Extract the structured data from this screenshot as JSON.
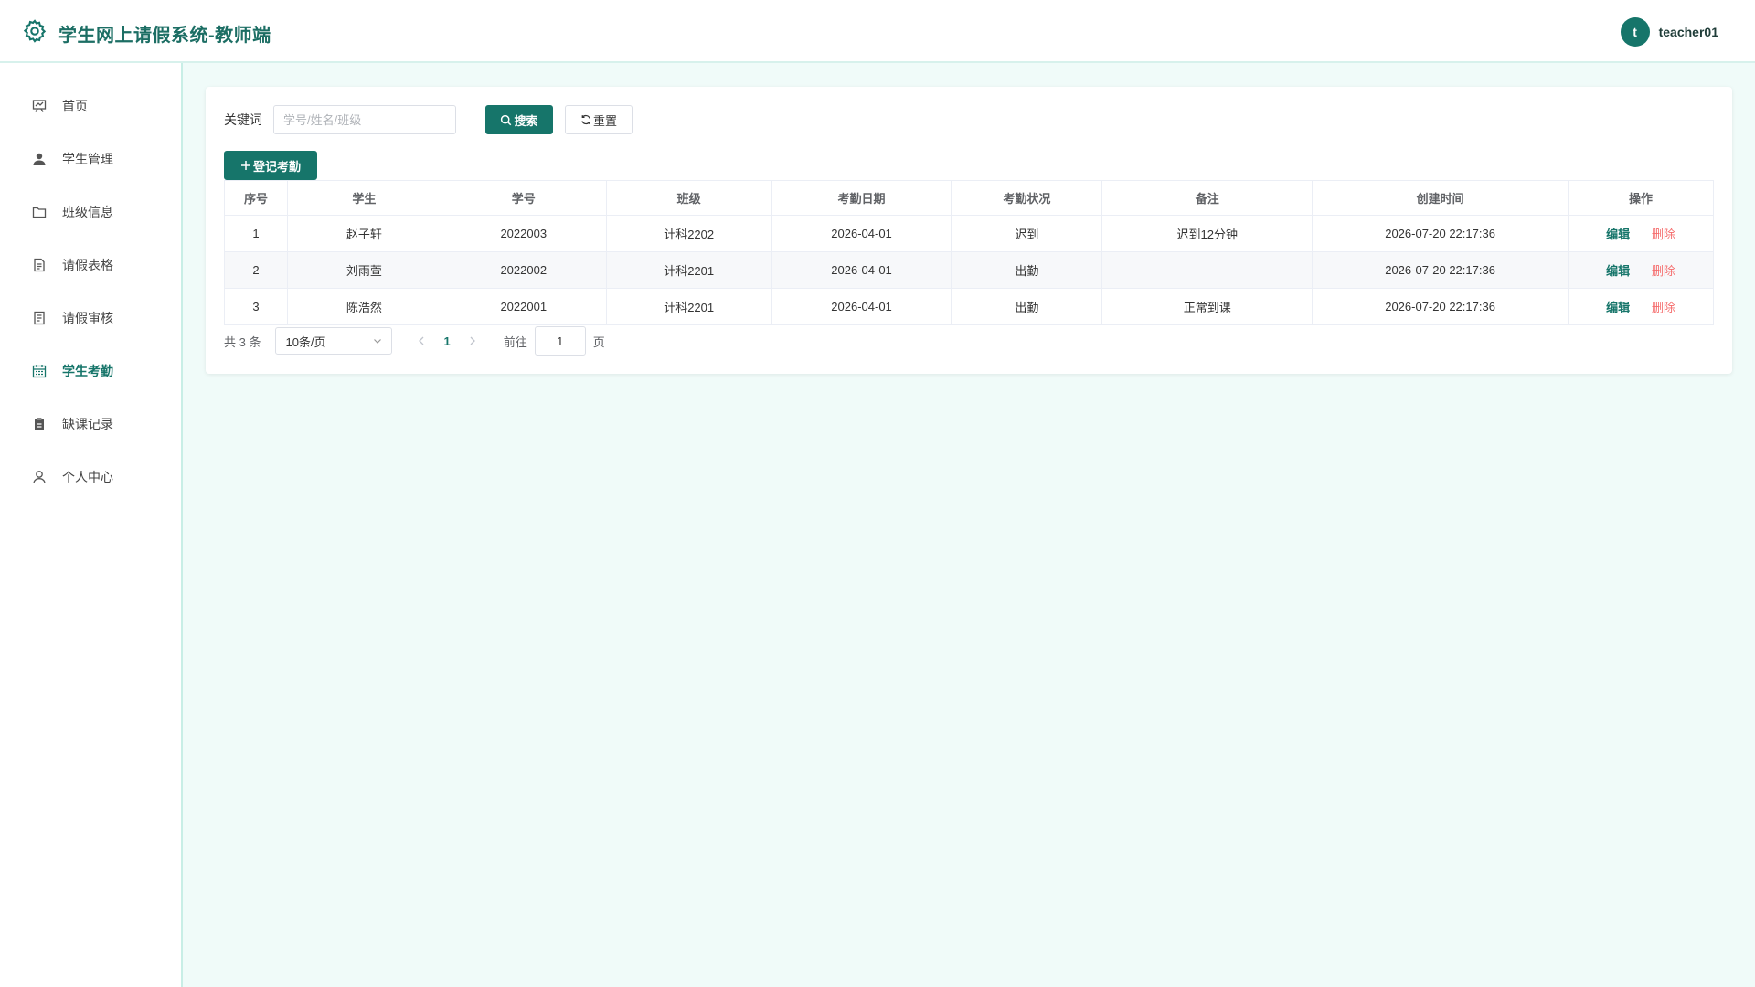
{
  "header": {
    "title": "学生网上请假系统-教师端",
    "logo_icon": "gear-icon",
    "avatar_letter": "t",
    "username": "teacher01"
  },
  "colors": {
    "primary": "#16756a",
    "danger": "#f56c6c",
    "background": "#f0fbf9"
  },
  "sidebar": {
    "items": [
      {
        "label": "首页",
        "icon": "presentation-icon",
        "active": false
      },
      {
        "label": "学生管理",
        "icon": "user-solid-icon",
        "active": false
      },
      {
        "label": "班级信息",
        "icon": "folder-icon",
        "active": false
      },
      {
        "label": "请假表格",
        "icon": "document-icon",
        "active": false
      },
      {
        "label": "请假审核",
        "icon": "document-check-icon",
        "active": false
      },
      {
        "label": "学生考勤",
        "icon": "calendar-icon",
        "active": true
      },
      {
        "label": "缺课记录",
        "icon": "clipboard-icon",
        "active": false
      },
      {
        "label": "个人中心",
        "icon": "user-outline-icon",
        "active": false
      }
    ]
  },
  "search": {
    "label": "关键词",
    "placeholder": "学号/姓名/班级",
    "value": "",
    "search_button": "搜索",
    "reset_button": "重置"
  },
  "toolbar": {
    "add_button": "登记考勤"
  },
  "table": {
    "columns": [
      "序号",
      "学生",
      "学号",
      "班级",
      "考勤日期",
      "考勤状况",
      "备注",
      "创建时间",
      "操作"
    ],
    "rows": [
      {
        "index": "1",
        "student": "赵子轩",
        "student_id": "2022003",
        "class": "计科2202",
        "date": "2026-04-01",
        "status": "迟到",
        "remark": "迟到12分钟",
        "created": "2026-07-20 22:17:36"
      },
      {
        "index": "2",
        "student": "刘雨萱",
        "student_id": "2022002",
        "class": "计科2201",
        "date": "2026-04-01",
        "status": "出勤",
        "remark": "",
        "created": "2026-07-20 22:17:36"
      },
      {
        "index": "3",
        "student": "陈浩然",
        "student_id": "2022001",
        "class": "计科2201",
        "date": "2026-04-01",
        "status": "出勤",
        "remark": "正常到课",
        "created": "2026-07-20 22:17:36"
      }
    ],
    "edit_label": "编辑",
    "delete_label": "删除"
  },
  "pagination": {
    "total_text": "共 3 条",
    "page_size": "10条/页",
    "current_page": "1",
    "goto_label": "前往",
    "goto_value": "1",
    "page_suffix": "页"
  }
}
